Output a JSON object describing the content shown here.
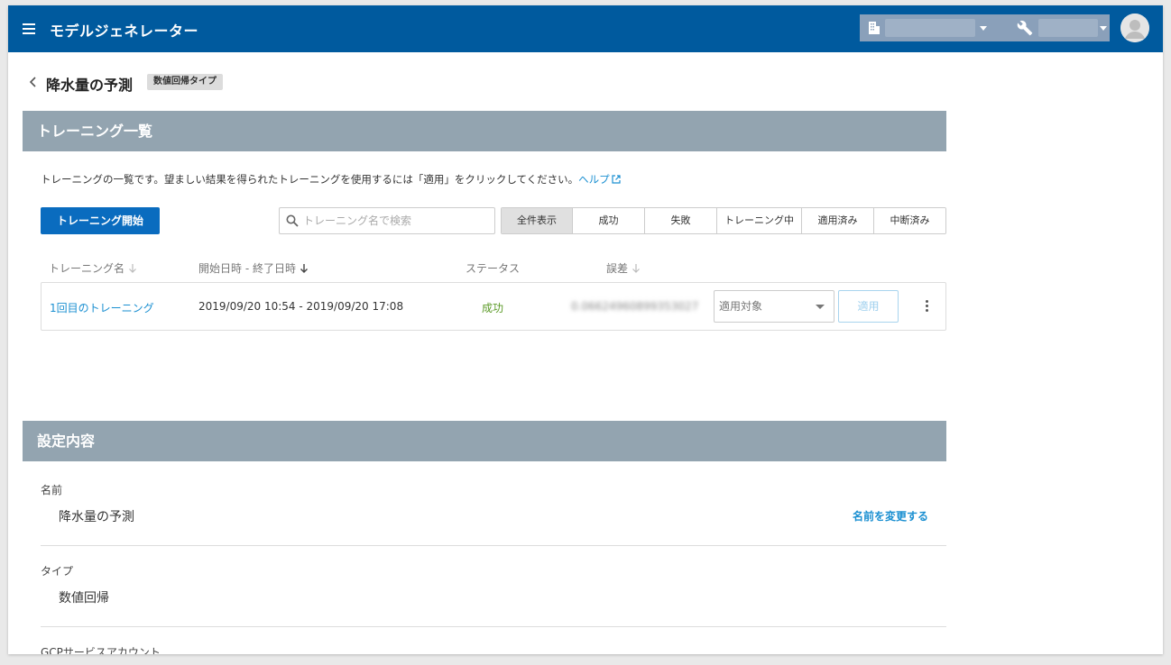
{
  "appbar": {
    "title": "モデルジェネレーター",
    "org_selector": "",
    "project_selector": ""
  },
  "page": {
    "title": "降水量の予測",
    "type_badge": "数値回帰タイプ"
  },
  "trainings_section": {
    "heading": "トレーニング一覧",
    "description": "トレーニングの一覧です。望ましい結果を得られたトレーニングを使用するには「適用」をクリックしてください。",
    "help_label": "ヘルプ",
    "start_button": "トレーニング開始",
    "search_placeholder": "トレーニング名で検索",
    "filters": [
      "全件表示",
      "成功",
      "失敗",
      "トレーニング中",
      "適用済み",
      "中断済み"
    ],
    "active_filter": "全件表示",
    "columns": {
      "name": "トレーニング名",
      "period": "開始日時 - 終了日時",
      "status": "ステータス",
      "error": "誤差"
    },
    "rows": [
      {
        "name": "1回目のトレーニング",
        "period": "2019/09/20 10:54 - 2019/09/20 17:08",
        "status": "成功",
        "error": "0.06624960899353027",
        "target_placeholder": "適用対象",
        "apply_label": "適用"
      }
    ]
  },
  "settings_section": {
    "heading": "設定内容",
    "name_label": "名前",
    "name_value": "降水量の予測",
    "rename_link": "名前を変更する",
    "type_label": "タイプ",
    "type_value": "数値回帰",
    "gcp_label": "GCPサービスアカウント"
  },
  "colors": {
    "appbar": "#005a9e",
    "section_header": "#93a4b0",
    "primary_button": "#0a6cbf",
    "link": "#1a8fd1",
    "success": "#5b9a27"
  }
}
